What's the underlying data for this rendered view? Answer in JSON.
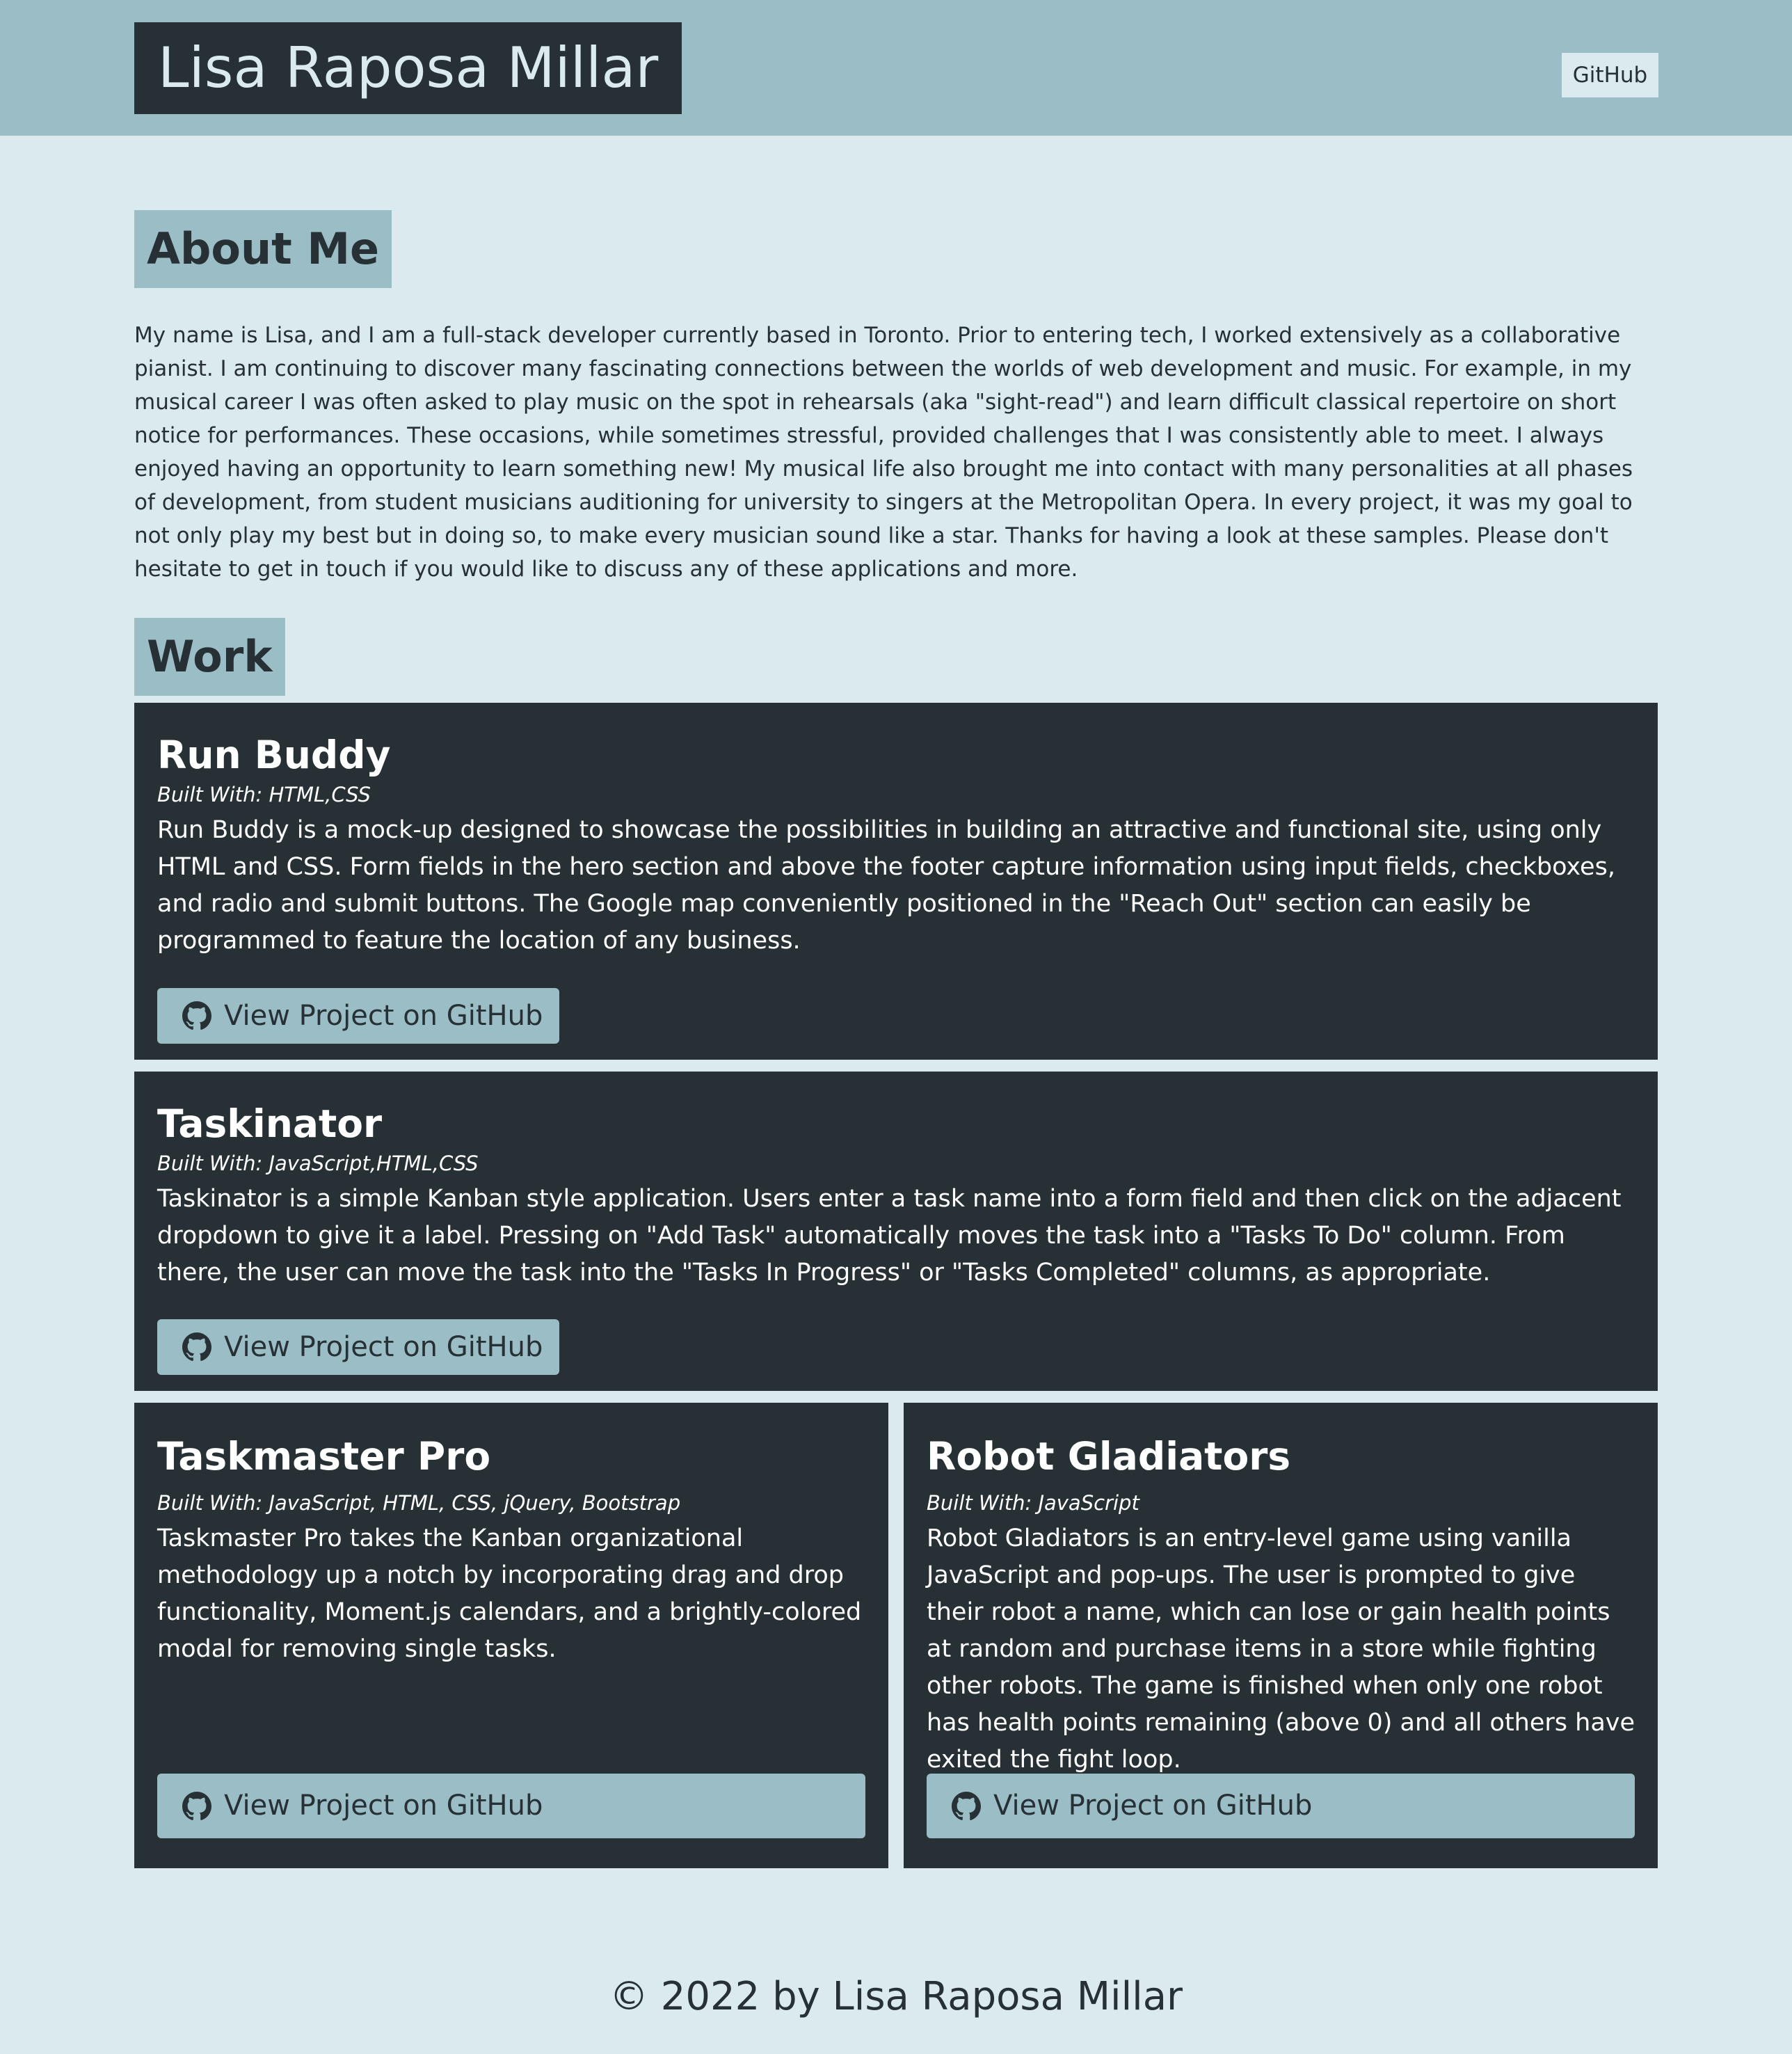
{
  "header": {
    "brand": "Lisa Raposa Millar",
    "nav_link": "GitHub"
  },
  "about": {
    "heading": "About Me",
    "text": "My name is Lisa, and I am a full-stack developer currently based in Toronto. Prior to entering tech, I worked extensively as a collaborative pianist. I am continuing to discover many fascinating connections between the worlds of web development and music. For example, in my musical career I was often asked to play music on the spot in rehearsals (aka \"sight-read\") and learn difficult classical repertoire on short notice for performances. These occasions, while sometimes stressful, provided challenges that I was consistently able to meet. I always enjoyed having an opportunity to learn something new! My musical life also brought me into contact with many personalities at all phases of development, from student musicians auditioning for university to singers at the Metropolitan Opera. In every project, it was my goal to not only play my best but in doing so, to make every musician sound like a star. Thanks for having a look at these samples. Please don't hesitate to get in touch if you would like to discuss any of these applications and more."
  },
  "work": {
    "heading": "Work",
    "projects": [
      {
        "title": "Run Buddy",
        "built_with": "Built With: HTML,CSS",
        "description": "Run Buddy is a mock-up designed to showcase the possibilities in building an attractive and functional site, using only HTML and CSS. Form fields in the hero section and above the footer capture information using input fields, checkboxes, and radio and submit buttons. The Google map conveniently positioned in the \"Reach Out\" section can easily be programmed to feature the location of any business.",
        "button_label": "View Project on GitHub",
        "button_icon": "github-icon"
      },
      {
        "title": "Taskinator",
        "built_with": "Built With: JavaScript,HTML,CSS",
        "description": "Taskinator is a simple Kanban style application. Users enter a task name into a form field and then click on the adjacent dropdown to give it a label. Pressing on \"Add Task\" automatically moves the task into a \"Tasks To Do\" column. From there, the user can move the task into the \"Tasks In Progress\" or \"Tasks Completed\" columns, as appropriate.",
        "button_label": "View Project on GitHub",
        "button_icon": "github-icon"
      },
      {
        "title": "Taskmaster Pro",
        "built_with": "Built With: JavaScript, HTML, CSS, jQuery, Bootstrap",
        "description": "Taskmaster Pro takes the Kanban organizational methodology up a notch by incorporating drag and drop functionality, Moment.js calendars, and a brightly-colored modal for removing single tasks.",
        "button_label": "View Project on GitHub",
        "button_icon": "github-icon"
      },
      {
        "title": "Robot Gladiators",
        "built_with": "Built With: JavaScript",
        "description": "Robot Gladiators is an entry-level game using vanilla JavaScript and pop-ups. The user is prompted to give their robot a name, which can lose or gain health points at random and purchase items in a store while fighting other robots. The game is finished when only one robot has health points remaining (above 0) and all others have exited the fight loop.",
        "button_label": "View Project on GitHub",
        "button_icon": "github-icon"
      }
    ]
  },
  "footer": {
    "text": "© 2022 by Lisa Raposa Millar"
  },
  "colors": {
    "header_bg": "#9bbdc6",
    "page_bg": "#dbeaee",
    "dark": "#263035",
    "button_bg": "#9bbdc6"
  }
}
